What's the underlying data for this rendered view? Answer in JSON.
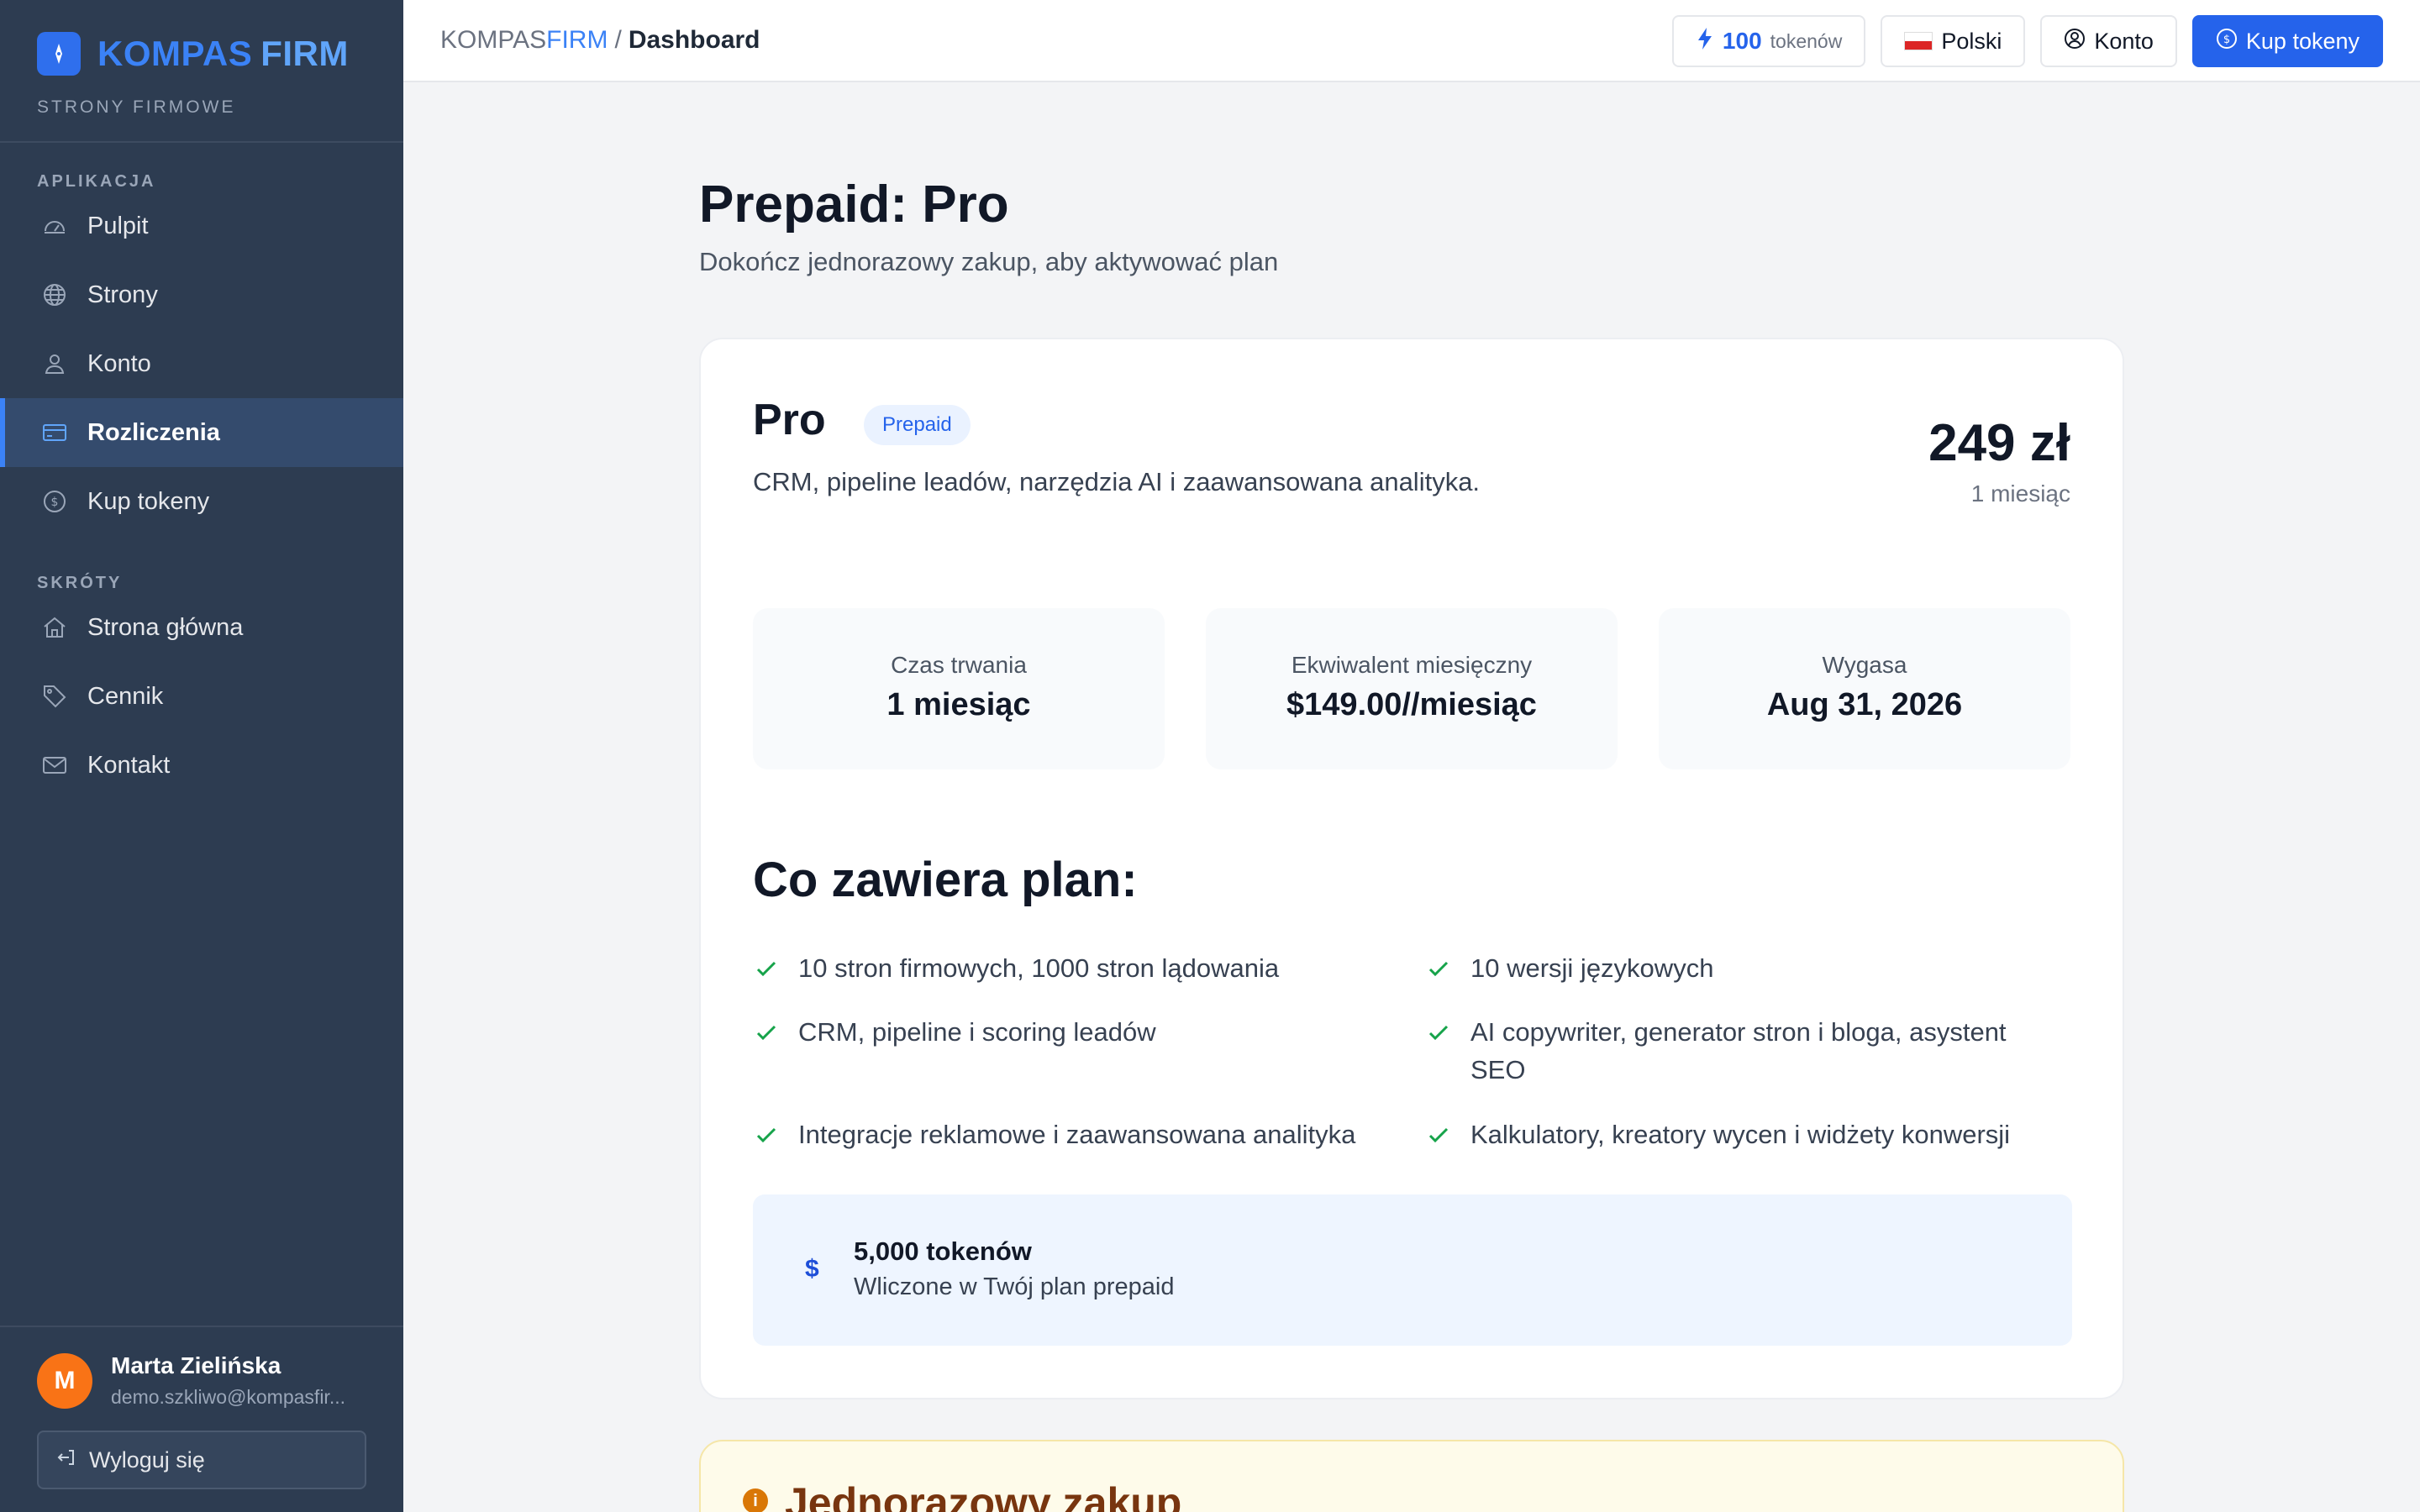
{
  "brand": {
    "name_part1": "KOMPAS",
    "name_part2": "FIRM",
    "subtitle": "STRONY FIRMOWE"
  },
  "sidebar": {
    "section_app": "APLIKACJA",
    "app_items": [
      {
        "label": "Pulpit",
        "icon": "gauge-icon"
      },
      {
        "label": "Strony",
        "icon": "globe-icon"
      },
      {
        "label": "Konto",
        "icon": "user-icon"
      },
      {
        "label": "Rozliczenia",
        "icon": "credit-card-icon",
        "active": true
      },
      {
        "label": "Kup tokeny",
        "icon": "coin-icon"
      }
    ],
    "section_shortcuts": "SKRÓTY",
    "shortcut_items": [
      {
        "label": "Strona główna",
        "icon": "home-icon"
      },
      {
        "label": "Cennik",
        "icon": "tag-icon"
      },
      {
        "label": "Kontakt",
        "icon": "mail-icon"
      }
    ]
  },
  "user": {
    "initial": "M",
    "name": "Marta Zielińska",
    "email": "demo.szkliwo@kompasfir...",
    "logout_label": "Wyloguj się"
  },
  "topbar": {
    "crumb_part1": "KOMPAS",
    "crumb_part2": "FIRM",
    "crumb_sep": "/",
    "crumb_current": "Dashboard",
    "tokens_count": "100",
    "tokens_label": "tokenów",
    "language": "Polski",
    "account_label": "Konto",
    "buy_label": "Kup tokeny"
  },
  "page": {
    "title": "Prepaid: Pro",
    "subtitle": "Dokończ jednorazowy zakup, aby aktywować plan"
  },
  "plan": {
    "name": "Pro",
    "badge": "Prepaid",
    "description": "CRM, pipeline leadów, narzędzia AI i zaawansowana analityka.",
    "price": "249 zł",
    "period": "1 miesiąc",
    "stats": [
      {
        "label": "Czas trwania",
        "value": "1 miesiąc"
      },
      {
        "label": "Ekwiwalent miesięczny",
        "value": "$149.00//miesiąc"
      },
      {
        "label": "Wygasa",
        "value": "Aug 31, 2026"
      }
    ],
    "includes_title": "Co zawiera plan:",
    "features": [
      "10 stron firmowych, 1000 stron lądowania",
      "10 wersji językowych",
      "CRM, pipeline i scoring leadów",
      "AI copywriter, generator stron i bloga, asystent SEO",
      "Integracje reklamowe i zaawansowana analityka",
      "Kalkulatory, kreatory wycen i widżety konwersji"
    ],
    "tokens_title": "5,000 tokenów",
    "tokens_note": "Wliczone w Twój plan prepaid",
    "tokens_symbol": "$"
  },
  "onetime": {
    "title": "Jednorazowy zakup"
  },
  "colors": {
    "accent": "#2563eb",
    "sidebar_bg": "#2d3c51",
    "check": "#16a34a",
    "avatar": "#f97316"
  }
}
